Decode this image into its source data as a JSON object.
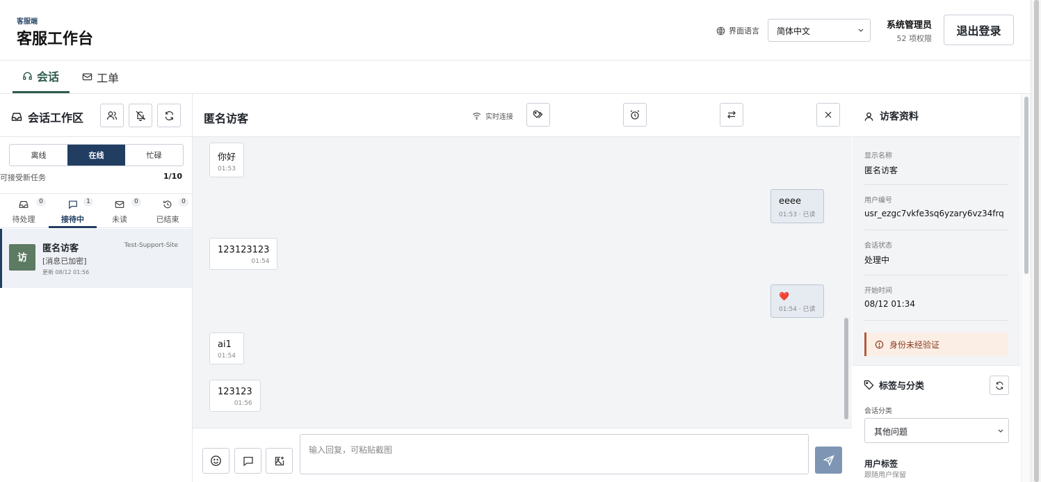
{
  "header": {
    "subtitle": "客服端",
    "title": "客服工作台",
    "lang_label": "界面语言",
    "lang_value": "简体中文",
    "admin_name": "系统管理员",
    "admin_perms": "52 项权限",
    "logout": "退出登录"
  },
  "tabs": [
    {
      "label": "会话",
      "icon": "headset-icon",
      "active": true
    },
    {
      "label": "工单",
      "icon": "ticket-icon",
      "active": false
    }
  ],
  "left": {
    "title": "会话工作区",
    "status": [
      "离线",
      "在线",
      "忙碌"
    ],
    "status_selected": "在线",
    "capacity_label": "可接受新任务",
    "capacity_value": "1/10",
    "conv_tabs": [
      {
        "label": "待处理",
        "count": "0"
      },
      {
        "label": "接待中",
        "count": "1"
      },
      {
        "label": "未读",
        "count": "0"
      },
      {
        "label": "已结束",
        "count": "0"
      }
    ],
    "conversation": {
      "avatar": "访",
      "name": "匿名访客",
      "site": "Test-Support-Site",
      "preview": "[消息已加密]",
      "updated": "更新 08/12 01:56"
    }
  },
  "chat": {
    "name": "匿名访客",
    "live": "实时连接",
    "messages": [
      {
        "text": "你好",
        "time": "01:53",
        "mine": false
      },
      {
        "text": "eeee",
        "time": "01:53 · 已读",
        "mine": true
      },
      {
        "text": "123123123",
        "time": "01:54",
        "mine": false
      },
      {
        "text": "❤️",
        "time": "01:54 · 已读",
        "mine": true
      },
      {
        "text": "ai1",
        "time": "01:54",
        "mine": false
      },
      {
        "text": "123123",
        "time": "01:56",
        "mine": false
      }
    ],
    "placeholder": "输入回复，可粘贴截图"
  },
  "visitor": {
    "title": "访客资料",
    "fields": [
      {
        "label": "显示名称",
        "value": "匿名访客"
      },
      {
        "label": "用户编号",
        "value": "usr_ezgc7vkfe3sq6yzary6vz34frq"
      },
      {
        "label": "会话状态",
        "value": "处理中"
      },
      {
        "label": "开始时间",
        "value": "08/12 01:34"
      }
    ],
    "warning": "身份未经验证",
    "tags_title": "标签与分类",
    "category_label": "会话分类",
    "category_value": "其他问题",
    "user_tags": "用户标签",
    "user_tags_sub": "跟随用户保留"
  },
  "colors": {
    "primary": "#213d62",
    "accent_green": "#2d5a4a",
    "warn": "#b35a3a"
  }
}
